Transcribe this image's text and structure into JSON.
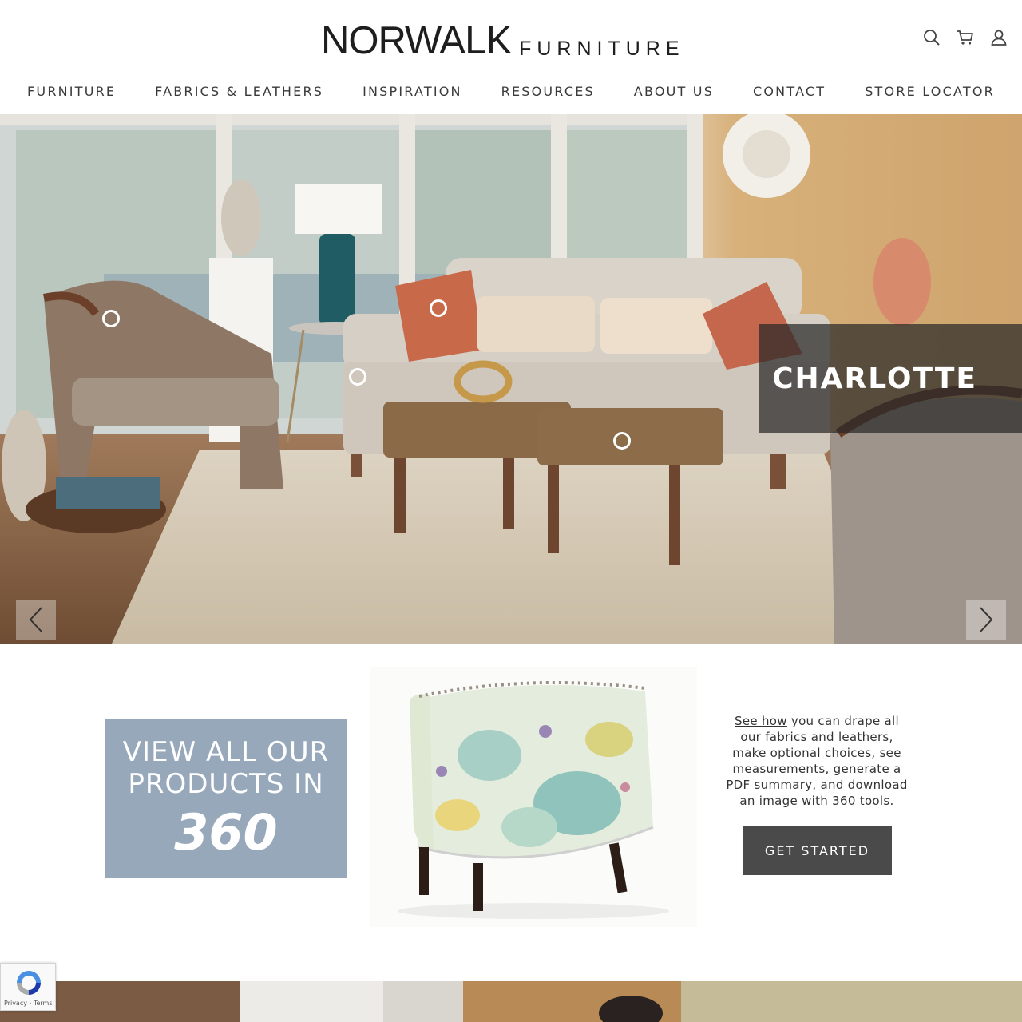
{
  "header": {
    "logo_main": "NORWALK",
    "logo_sub": "FURNITURE",
    "icons": [
      "search-icon",
      "cart-icon",
      "account-icon"
    ]
  },
  "nav": {
    "items": [
      "FURNITURE",
      "FABRICS & LEATHERS",
      "INSPIRATION",
      "RESOURCES",
      "ABOUT US",
      "CONTACT",
      "STORE LOCATOR"
    ]
  },
  "hero": {
    "caption": "CHARLOTTE",
    "prev_icon": "chevron-left-icon",
    "next_icon": "chevron-right-icon"
  },
  "promo": {
    "line1": "VIEW ALL OUR",
    "line2": "PRODUCTS IN",
    "number": "360",
    "link_text": "See how",
    "body_text": " you can drape all our fabrics and leathers, make optional choices, see measurements, generate a PDF summary, and download an image with 360 tools.",
    "button_label": "GET STARTED"
  },
  "recaptcha": {
    "privacy": "Privacy",
    "separator": " - ",
    "terms": "Terms"
  },
  "colors": {
    "promo_box": "#97a8bb",
    "button": "#4a4a4a",
    "caption_bg": "#282828"
  }
}
